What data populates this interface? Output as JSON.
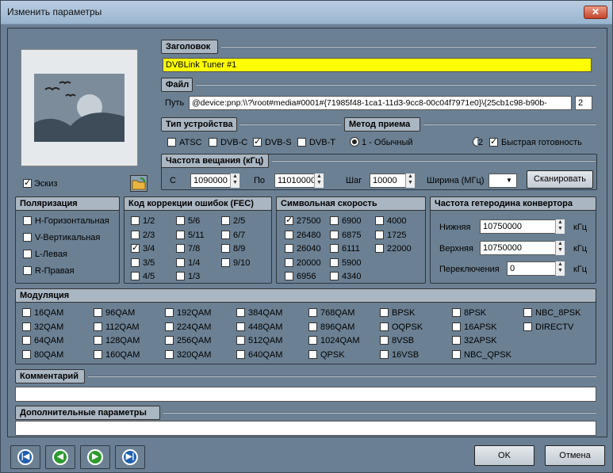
{
  "window": {
    "title": "Изменить параметры",
    "close_icon": "close-icon"
  },
  "preview": {
    "sketch_label": "Эскиз",
    "sketch_checked": true
  },
  "title_section": {
    "header": "Заголовок",
    "value": "DVBLink Tuner #1",
    "highlight_color": "#ffff00"
  },
  "file_section": {
    "header": "Файл",
    "path_label": "Путь",
    "path_value": "@device:pnp:\\\\?\\root#media#0001#{71985f48-1ca1-11d3-9cc8-00c04f7971e0}\\{25cb1c98-b90b-",
    "index_value": "2"
  },
  "device_type": {
    "header": "Тип устройства",
    "options": [
      {
        "label": "ATSC",
        "checked": false
      },
      {
        "label": "DVB-C",
        "checked": false
      },
      {
        "label": "DVB-S",
        "checked": true
      },
      {
        "label": "DVB-T",
        "checked": false
      }
    ]
  },
  "reception": {
    "header": "Метод приема",
    "option1": "1 - Обычный",
    "option2": "2",
    "fast_ready": "Быстрая готовность",
    "fast_ready_checked": true
  },
  "freq": {
    "header": "Частота вещания (кГц)",
    "from_label": "С",
    "from_value": "1090000",
    "to_label": "По",
    "to_value": "11010000",
    "step_label": "Шаг",
    "step_value": "10000",
    "width_label": "Ширина (МГц)",
    "scan_button": "Сканировать"
  },
  "polarization": {
    "header": "Поляризация",
    "items": [
      "H-Горизонтальная",
      "V-Вертикальная",
      "L-Левая",
      "R-Правая"
    ]
  },
  "fec": {
    "header": "Код коррекции ошибок (FEC)",
    "col1": [
      {
        "label": "1/2",
        "checked": false
      },
      {
        "label": "2/3",
        "checked": false
      },
      {
        "label": "3/4",
        "checked": true
      },
      {
        "label": "3/5",
        "checked": false
      },
      {
        "label": "4/5",
        "checked": false
      }
    ],
    "col2": [
      "5/6",
      "5/11",
      "7/8",
      "1/4",
      "1/3"
    ],
    "col3": [
      "2/5",
      "6/7",
      "8/9",
      "9/10"
    ]
  },
  "symbol_rate": {
    "header": "Символьная скорость",
    "col1": [
      {
        "label": "27500",
        "checked": true
      },
      {
        "label": "26480",
        "checked": false
      },
      {
        "label": "26040",
        "checked": false
      },
      {
        "label": "20000",
        "checked": false
      },
      {
        "label": "6956",
        "checked": false
      }
    ],
    "col2": [
      "6900",
      "6875",
      "6111",
      "5900",
      "4340"
    ],
    "col3": [
      "4000",
      "1725",
      "22000"
    ]
  },
  "lnb": {
    "header": "Частота гетеродина конвертора",
    "low_label": "Нижняя",
    "low_value": "10750000",
    "high_label": "Верхняя",
    "high_value": "10750000",
    "switch_label": "Переключения",
    "switch_value": "0",
    "unit": "кГц"
  },
  "modulation": {
    "header": "Модуляция",
    "columns": [
      [
        "16QAM",
        "32QAM",
        "64QAM",
        "80QAM"
      ],
      [
        "96QAM",
        "112QAM",
        "128QAM",
        "160QAM"
      ],
      [
        "192QAM",
        "224QAM",
        "256QAM",
        "320QAM"
      ],
      [
        "384QAM",
        "448QAM",
        "512QAM",
        "640QAM"
      ],
      [
        "768QAM",
        "896QAM",
        "1024QAM",
        "QPSK"
      ],
      [
        "BPSK",
        "OQPSK",
        "8VSB",
        "16VSB"
      ],
      [
        "8PSK",
        "16APSK",
        "32APSK",
        "NBC_QPSK"
      ],
      [
        "NBC_8PSK",
        "DIRECTV"
      ]
    ]
  },
  "comment": {
    "header": "Комментарий",
    "value": ""
  },
  "extra": {
    "header": "Дополнительные параметры",
    "value": ""
  },
  "footer": {
    "ok": "OK",
    "cancel": "Отмена",
    "nav_icons": [
      "first-icon",
      "prev-icon",
      "next-icon",
      "last-icon"
    ]
  }
}
